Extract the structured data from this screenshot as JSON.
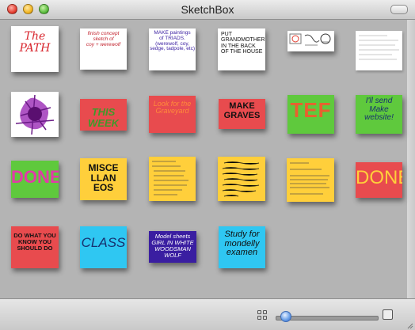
{
  "window": {
    "title": "SketchBox"
  },
  "slider": {
    "level_percent": 5
  },
  "colors": {
    "white": "#ffffff",
    "red": "#e84b4e",
    "yellow": "#ffcf3b",
    "green": "#5fc93d",
    "cyan": "#2fc7f2",
    "purple": "#3a1ea1",
    "black": "#111111"
  },
  "sketches": [
    {
      "name": "sketch-the-path",
      "text": "The\nPATH",
      "ink": "#d8262e"
    },
    {
      "name": "sketch-finish-concept",
      "text": "finish concept\nsketch of\ncoy + werewolf",
      "ink": "#c3242f"
    },
    {
      "name": "sketch-make-paintings",
      "text": "MAKE paintings\nof TRIADS.\n(werewolf, coy, sedge, tadpole, etc)",
      "ink": "#3a1ea1"
    },
    {
      "name": "sketch-grandmother",
      "text": "PUT\nGRANDMOTHER\nIN THE BACK\nOF THE HOUSE",
      "ink": "#111111"
    },
    {
      "name": "sketch-drawings",
      "text": "",
      "ink": "#444444"
    },
    {
      "name": "sketch-notes-white",
      "text": "",
      "ink": "#bfbfbf"
    },
    {
      "name": "sketch-purple-splat",
      "text": "",
      "ink": "#7a1e9b"
    },
    {
      "name": "sketch-graveyard-this-week",
      "text": "THIS WEEK",
      "ink": "#3e9a2a"
    },
    {
      "name": "sketch-look-for-graveyard",
      "text": "Look for the\nGraveyard",
      "ink": "#ff8a3b"
    },
    {
      "name": "sketch-make-graves",
      "text": "MAKE\nGRAVES",
      "ink": "#111111"
    },
    {
      "name": "sketch-tef",
      "text": "TEF",
      "ink": "#e8612f"
    },
    {
      "name": "sketch-make-website",
      "text": "I'll send\nMake\nwebsite!",
      "ink": "#17306e"
    },
    {
      "name": "sketch-done-green",
      "text": "DONE",
      "ink": "#e23aa8"
    },
    {
      "name": "sketch-miscellaneous",
      "text": "MISCE\nLLAN\nEOS",
      "ink": "#111111"
    },
    {
      "name": "sketch-trip-list",
      "text": "",
      "ink": "#5a4a2a"
    },
    {
      "name": "sketch-notes-yellow",
      "text": "",
      "ink": "#3b3317"
    },
    {
      "name": "sketch-study-notes",
      "text": "",
      "ink": "#5a4a2a"
    },
    {
      "name": "sketch-done-red",
      "text": "DONE",
      "ink": "#ffcf3b"
    },
    {
      "name": "sketch-do-what-you-know",
      "text": "DO WHAT YOU\nKNOW YOU\nSHOULD DO",
      "ink": "#111111"
    },
    {
      "name": "sketch-class",
      "text": "CLASS",
      "ink": "#17306e"
    },
    {
      "name": "sketch-model-sheets",
      "text": "Model sheets\nGIRL IN WHITE\nWOODSMAN WOLF",
      "ink": "#ffffff"
    },
    {
      "name": "sketch-study-mondelly",
      "text": "Study for\nmondelly\nexamen",
      "ink": "#111111"
    }
  ]
}
